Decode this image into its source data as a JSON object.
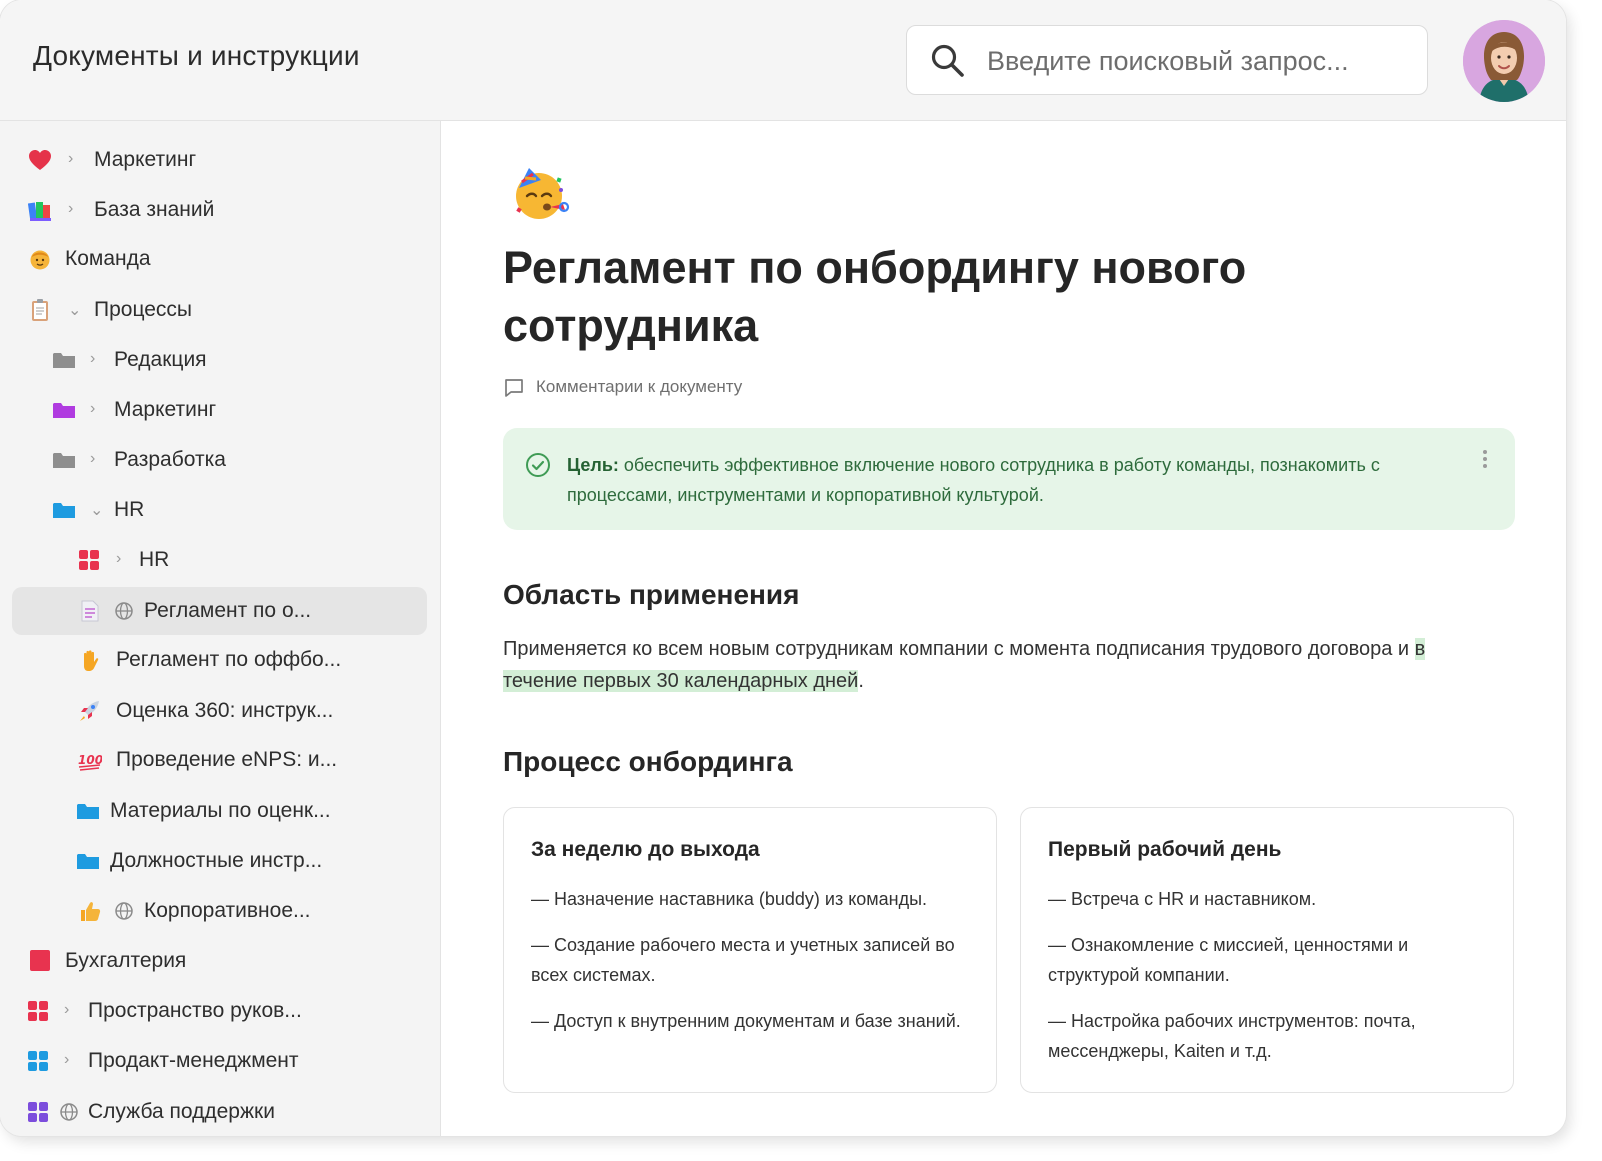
{
  "header": {
    "title": "Документы и инструкции",
    "search_placeholder": "Введите поисковый запрос..."
  },
  "sidebar": {
    "items": [
      {
        "label": "Маркетинг",
        "icon": "heart-icon"
      },
      {
        "label": "База знаний",
        "icon": "books-icon"
      },
      {
        "label": "Команда",
        "icon": "face-icon"
      },
      {
        "label": "Процессы",
        "icon": "clipboard-icon"
      },
      {
        "label": "Редакция",
        "icon": "folder-icon"
      },
      {
        "label": "Маркетинг",
        "icon": "folder-icon"
      },
      {
        "label": "Разработка",
        "icon": "folder-icon"
      },
      {
        "label": "HR",
        "icon": "folder-icon"
      },
      {
        "label": "HR",
        "icon": "grid-icon"
      },
      {
        "label": "Регламент по о...",
        "icon": "document-icon"
      },
      {
        "label": "Регламент по оффбо...",
        "icon": "hand-icon"
      },
      {
        "label": "Оценка 360: инструк...",
        "icon": "rocket-icon"
      },
      {
        "label": "Проведение eNPS: и...",
        "icon": "hundred-icon"
      },
      {
        "label": "Материалы по оценк...",
        "icon": "folder-icon"
      },
      {
        "label": "Должностные инстр...",
        "icon": "folder-icon"
      },
      {
        "label": "Корпоративное...",
        "icon": "thumbs-up-icon"
      },
      {
        "label": "Бухгалтерия",
        "icon": "square-icon"
      },
      {
        "label": "Пространство руков...",
        "icon": "grid-icon"
      },
      {
        "label": "Продакт-менеджмент",
        "icon": "grid-icon"
      },
      {
        "label": "Служба поддержки",
        "icon": "grid-icon"
      }
    ]
  },
  "document": {
    "title": "Регламент по онбордингу нового сотрудника",
    "comments_label": "Комментарии к документу",
    "callout": {
      "label": "Цель:",
      "text": " обеспечить эффективное включение нового сотрудника в работу команды, познакомить с процессами, инструментами и корпоративной культурой."
    },
    "scope": {
      "heading": "Область применения",
      "text_before": "Применяется ко всем новым сотрудникам компании с момента подписания трудового договора и ",
      "text_highlight": "в течение первых 30 календарных дней",
      "text_after": "."
    },
    "process": {
      "heading": "Процесс онбординга",
      "cards": [
        {
          "title": "За неделю до выхода",
          "items": [
            "— Назначение наставника (buddy) из команды.",
            "— Создание рабочего места и учетных записей во всех системах.",
            "— Доступ к внутренним документам и базе знаний."
          ]
        },
        {
          "title": "Первый рабочий день",
          "items": [
            "— Встреча с HR и наставником.",
            "— Ознакомление с миссией, ценностями и структурой компании.",
            "— Настройка рабочих инструментов: почта, мессенджеры, Kaiten и т.д."
          ]
        }
      ]
    }
  },
  "colors": {
    "callout_bg": "#e6f5e8",
    "callout_text": "#2e6b3c",
    "highlight": "#d3eed6",
    "sidebar_bg": "#f4f4f4",
    "active_item_bg": "#e5e5e5"
  }
}
